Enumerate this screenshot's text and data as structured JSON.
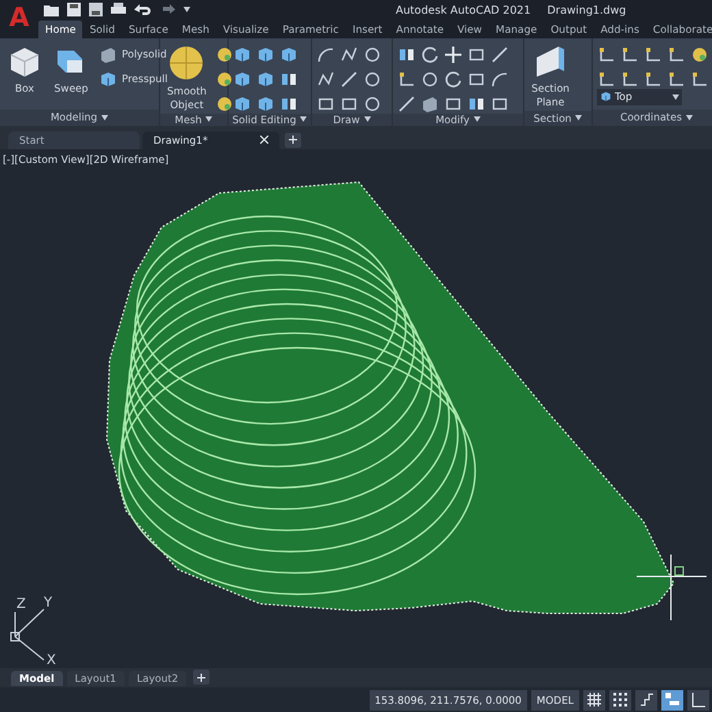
{
  "app_logo": "A",
  "title_bar": {
    "app": "Autodesk AutoCAD 2021",
    "file": "Drawing1.dwg"
  },
  "ribbon_tabs": [
    {
      "label": "Home",
      "selected": true
    },
    {
      "label": "Solid",
      "selected": false
    },
    {
      "label": "Surface",
      "selected": false
    },
    {
      "label": "Mesh",
      "selected": false
    },
    {
      "label": "Visualize",
      "selected": false
    },
    {
      "label": "Parametric",
      "selected": false
    },
    {
      "label": "Insert",
      "selected": false
    },
    {
      "label": "Annotate",
      "selected": false
    },
    {
      "label": "View",
      "selected": false
    },
    {
      "label": "Manage",
      "selected": false
    },
    {
      "label": "Output",
      "selected": false
    },
    {
      "label": "Add-ins",
      "selected": false
    },
    {
      "label": "Collaborate",
      "selected": false
    }
  ],
  "panels": [
    {
      "kind": "modeling",
      "title": "Modeling",
      "large": [
        "Box",
        "Sweep"
      ],
      "small": [
        "Polysolid",
        "Presspull"
      ]
    },
    {
      "kind": "mesh",
      "title": "Mesh",
      "large": [
        "Smooth Object"
      ]
    },
    {
      "kind": "solid-editing",
      "title": "Solid Editing"
    },
    {
      "kind": "draw",
      "title": "Draw"
    },
    {
      "kind": "modify",
      "title": "Modify"
    },
    {
      "kind": "section",
      "title": "Section",
      "large": [
        "Section Plane"
      ]
    },
    {
      "kind": "coordinates",
      "title": "Coordinates",
      "view": "Top"
    }
  ],
  "document_tabs": [
    {
      "label": "Start",
      "selected": false
    },
    {
      "label": "Drawing1*",
      "selected": true
    }
  ],
  "viewport_label": "[-][Custom View][2D Wireframe]",
  "axes": {
    "z": "Z",
    "y": "Y",
    "x": "X"
  },
  "layout_tabs": [
    {
      "label": "Model",
      "selected": true
    },
    {
      "label": "Layout1",
      "selected": false
    },
    {
      "label": "Layout2",
      "selected": false
    }
  ],
  "status_bar": {
    "coordinates": "153.8096, 211.7576, 0.0000",
    "space": "MODEL",
    "toggles": [
      {
        "kind": "grid",
        "on": false
      },
      {
        "kind": "snap",
        "on": false
      },
      {
        "kind": "infer",
        "on": false
      },
      {
        "kind": "dynamic",
        "on": true
      },
      {
        "kind": "ortho",
        "on": false
      }
    ]
  }
}
